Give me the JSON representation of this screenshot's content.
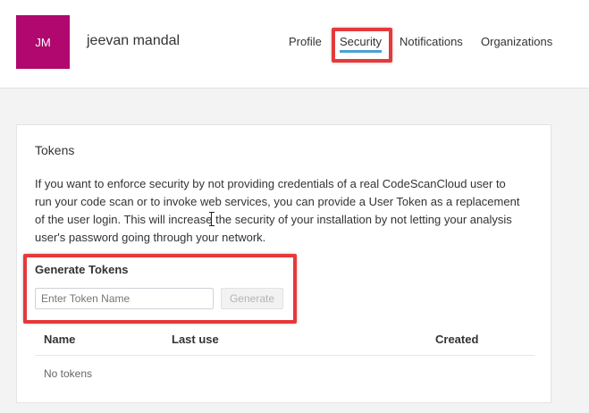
{
  "user": {
    "initials": "JM",
    "name": "jeevan mandal",
    "avatar_color": "#b0086e"
  },
  "nav": {
    "items": [
      {
        "label": "Profile",
        "active": false
      },
      {
        "label": "Security",
        "active": true
      },
      {
        "label": "Notifications",
        "active": false
      },
      {
        "label": "Organizations",
        "active": false
      }
    ]
  },
  "tokens": {
    "title": "Tokens",
    "description": "If you want to enforce security by not providing credentials of a real CodeScanCloud user to run your code scan or to invoke web services, you can provide a User Token as a replacement of the user login. This will increase the security of your installation by not letting your analysis user's password going through your network.",
    "generate_title": "Generate Tokens",
    "input_value": "",
    "input_placeholder": "Enter Token Name",
    "generate_label": "Generate",
    "columns": [
      "Name",
      "Last use",
      "Created"
    ],
    "empty_text": "No tokens"
  },
  "colors": {
    "accent": "#4b9fd5",
    "highlight": "#e5393b"
  }
}
